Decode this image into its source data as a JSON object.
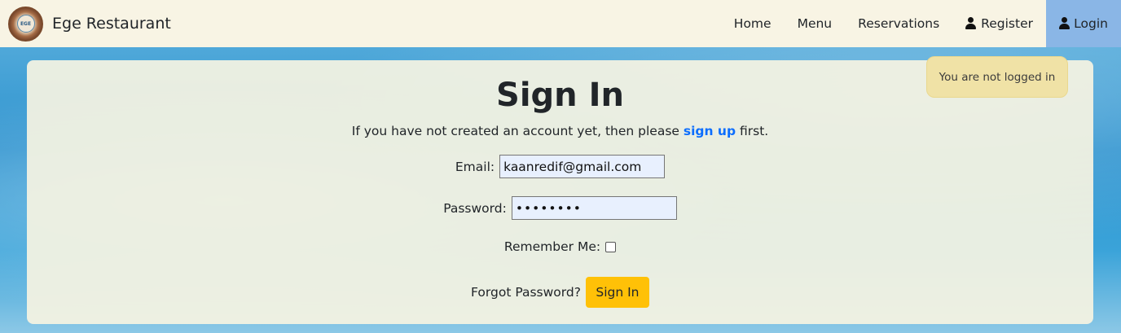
{
  "brand": {
    "name": "Ege Restaurant",
    "logo_text": "EGE"
  },
  "nav": {
    "home": "Home",
    "menu": "Menu",
    "reservations": "Reservations",
    "register": "Register",
    "login": "Login"
  },
  "alert": {
    "message": "You are not logged in"
  },
  "form": {
    "title": "Sign In",
    "subtitle_before": "If you have not created an account yet, then please ",
    "subtitle_link": "sign up",
    "subtitle_after": " first.",
    "email_label": "Email:",
    "email_value": "kaanredif@gmail.com",
    "password_label": "Password:",
    "password_value": "••••••••",
    "remember_label": "Remember Me:",
    "forgot_label": "Forgot Password?",
    "submit_label": "Sign In"
  },
  "colors": {
    "navbar_bg": "#f8f4e4",
    "active_nav_bg": "#8ab6e6",
    "link": "#0d6efd",
    "button": "#ffc107",
    "alert_bg": "#f0e2a6"
  }
}
